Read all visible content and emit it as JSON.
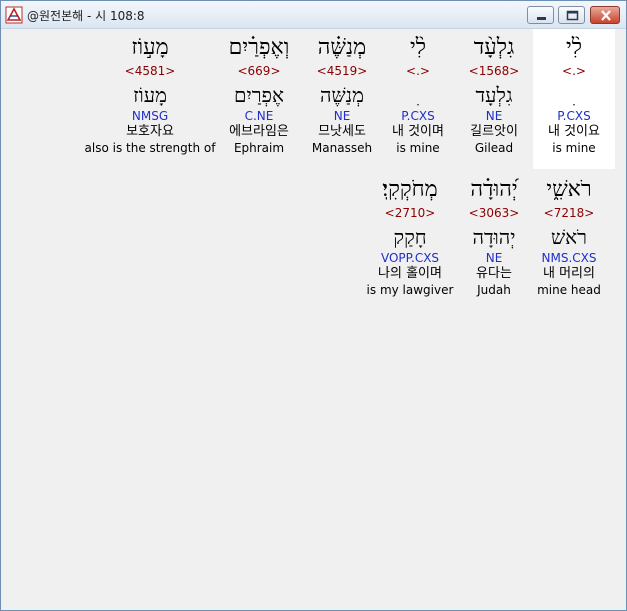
{
  "window": {
    "title": "@원전본해 - 시 108:8",
    "icon": "app-icon",
    "controls": [
      "minimize-icon",
      "maximize-icon",
      "close-icon"
    ]
  },
  "rows": [
    {
      "words": [
        {
          "heb": "לִ֨י",
          "strong": "<.>",
          "lemma": "ִ",
          "morph": "P.CXS",
          "kor": "내 것이요",
          "eng": "is mine",
          "selected": true
        },
        {
          "heb": "גִלְעָ֨ד",
          "strong": "<1568>",
          "lemma": "גִלְעָד",
          "morph": "NE",
          "kor": "길르앗이",
          "eng": "Gilead"
        },
        {
          "heb": "לִ֨י",
          "strong": "<.>",
          "lemma": "ִ",
          "morph": "P.CXS",
          "kor": "내 것이며",
          "eng": "is mine"
        },
        {
          "heb": "מְנַשֶּׁ֗ה",
          "strong": "<4519>",
          "lemma": "מְנַשֶּׁה",
          "morph": "NE",
          "kor": "므낫세도",
          "eng": "Manasseh"
        },
        {
          "heb": "וְאֶפְרַ֗יִם",
          "strong": "<669>",
          "lemma": "אֶפְרַיִם",
          "morph": "C.NE",
          "kor": "에브라임은",
          "eng": "Ephraim"
        },
        {
          "heb": "מָע֣וֹז",
          "strong": "<4581>",
          "lemma": "מָעוֹז",
          "morph": "NMSG",
          "kor": "보호자요",
          "eng": "also is the strength of"
        }
      ]
    },
    {
      "words": [
        {
          "heb": "רֹאשִׁ֑י",
          "strong": "<7218>",
          "lemma": "רֹאשׁ",
          "morph": "NMS.CXS",
          "kor": "내 머리의",
          "eng": "mine head"
        },
        {
          "heb": "יְ֝הוּדָ֗ה",
          "strong": "<3063>",
          "lemma": "יְהוּדָה",
          "morph": "NE",
          "kor": "유다는",
          "eng": "Judah"
        },
        {
          "heb": "מְחֹקְקִֽי׃",
          "strong": "<2710>",
          "lemma": "חָקַק",
          "morph": "VOPP.CXS",
          "kor": "나의 홀이며",
          "eng": "is my lawgiver"
        }
      ]
    }
  ]
}
